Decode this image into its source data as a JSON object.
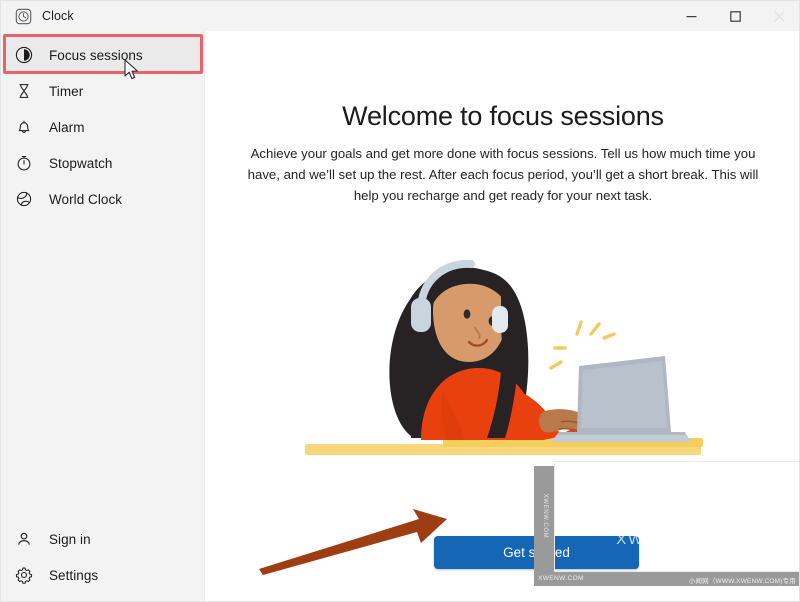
{
  "window": {
    "title": "Clock",
    "title_icon": "clock-icon",
    "controls": {
      "minimize": "Minimize",
      "maximize": "Maximize",
      "close": "Close"
    }
  },
  "sidebar": {
    "items": [
      {
        "label": "Focus sessions",
        "icon": "focus-sessions-icon",
        "selected": true
      },
      {
        "label": "Timer",
        "icon": "timer-hourglass-icon",
        "selected": false
      },
      {
        "label": "Alarm",
        "icon": "alarm-bell-icon",
        "selected": false
      },
      {
        "label": "Stopwatch",
        "icon": "stopwatch-icon",
        "selected": false
      },
      {
        "label": "World Clock",
        "icon": "globe-icon",
        "selected": false
      }
    ],
    "bottom_items": [
      {
        "label": "Sign in",
        "icon": "person-icon"
      },
      {
        "label": "Settings",
        "icon": "gear-icon"
      }
    ]
  },
  "main": {
    "heading": "Welcome to focus sessions",
    "description": "Achieve your goals and get more done with focus sessions. Tell us how much time you have, and we’ll set up the rest. After each focus period, you’ll get a short break. This will help you recharge and get ready for your next task.",
    "get_started_label": "Get started",
    "illustration": "woman-with-headphones-at-laptop-illustration"
  },
  "annotations": {
    "highlight_rect_color": "#e8636b",
    "arrow_color": "#9e3c12",
    "cursor": "mouse-pointer"
  },
  "watermark": {
    "logo_text": "小闻网",
    "sub_text": "XWENW.COM",
    "vertical_text": "XWENW.COM",
    "bottom_left_text": "XWENW.COM",
    "bottom_right_text": "小闻网（WWW.XWENW.COM)专用"
  },
  "colors": {
    "accent_blue": "#1567b5",
    "selection_pill": "#2f5bb7",
    "sidebar_bg": "#f3f3f3",
    "content_bg": "#ffffff",
    "shirt_red": "#e8400e",
    "desk_yellow": "#f5cf5d",
    "hair_black": "#272324",
    "skin": "#d79b6b"
  }
}
